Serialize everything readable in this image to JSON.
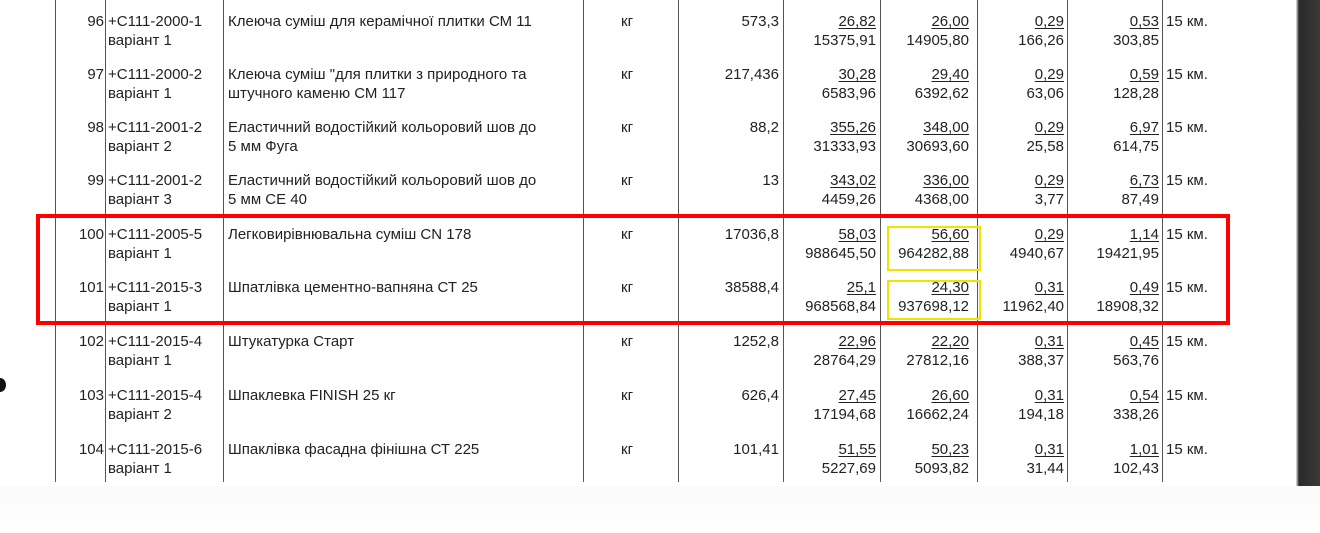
{
  "rows": [
    {
      "no": "96",
      "code": "+С111-2000-1",
      "variant": "варіант 1",
      "name1": "Клеюча суміш для керамічної плитки   СМ 11",
      "name2": "",
      "unit": "кг",
      "qty": "573,3",
      "c1": "26,82",
      "c1b": "15375,91",
      "c2": "26,00",
      "c2b": "14905,80",
      "c3": "0,29",
      "c3b": "166,26",
      "c4": "0,53",
      "c4b": "303,85",
      "dist": "15 км."
    },
    {
      "no": "97",
      "code": "+С111-2000-2",
      "variant": "варіант 1",
      "name1": "Клеюча суміш \"для плитки з природного та",
      "name2": "штучного каменю  СМ 117",
      "unit": "кг",
      "qty": "217,436",
      "c1": "30,28",
      "c1b": "6583,96",
      "c2": "29,40",
      "c2b": "6392,62",
      "c3": "0,29",
      "c3b": "63,06",
      "c4": "0,59",
      "c4b": "128,28",
      "dist": "15 км."
    },
    {
      "no": "98",
      "code": "+С111-2001-2",
      "variant": "варіант 2",
      "name1": "Еластичний водостійкий кольоровий шов до",
      "name2": "5 мм Фуга",
      "unit": "кг",
      "qty": "88,2",
      "c1": "355,26",
      "c1b": "31333,93",
      "c2": "348,00",
      "c2b": "30693,60",
      "c3": "0,29",
      "c3b": "25,58",
      "c4": "6,97",
      "c4b": "614,75",
      "dist": "15 км."
    },
    {
      "no": "99",
      "code": "+С111-2001-2",
      "variant": "варіант 3",
      "name1": "Еластичний водостійкий кольоровий шов до",
      "name2": "5 мм СЕ 40",
      "unit": "кг",
      "qty": "13",
      "c1": "343,02",
      "c1b": "4459,26",
      "c2": "336,00",
      "c2b": "4368,00",
      "c3": "0,29",
      "c3b": "3,77",
      "c4": "6,73",
      "c4b": "87,49",
      "dist": "15 км."
    },
    {
      "no": "100",
      "code": "+С111-2005-5",
      "variant": "варіант 1",
      "name1": "Легковирівнювальна суміш CN 178",
      "name2": "",
      "unit": "кг",
      "qty": "17036,8",
      "c1": "58,03",
      "c1b": "988645,50",
      "c2": "56,60",
      "c2b": "964282,88",
      "c3": "0,29",
      "c3b": "4940,67",
      "c4": "1,14",
      "c4b": "19421,95",
      "dist": "15 км."
    },
    {
      "no": "101",
      "code": "+С111-2015-3",
      "variant": "варіант 1",
      "name1": "Шпатлівка цементно-вапняна СТ 25",
      "name2": "",
      "unit": "кг",
      "qty": "38588,4",
      "c1": "25,1",
      "c1b": "968568,84",
      "c2": "24,30",
      "c2b": "937698,12",
      "c3": "0,31",
      "c3b": "11962,40",
      "c4": "0,49",
      "c4b": "18908,32",
      "dist": "15 км."
    },
    {
      "no": "102",
      "code": "+С111-2015-4",
      "variant": "варіант 1",
      "name1": "Штукатурка Старт",
      "name2": "",
      "unit": "кг",
      "qty": "1252,8",
      "c1": "22,96",
      "c1b": "28764,29",
      "c2": "22,20",
      "c2b": "27812,16",
      "c3": "0,31",
      "c3b": "388,37",
      "c4": "0,45",
      "c4b": "563,76",
      "dist": "15 км."
    },
    {
      "no": "103",
      "code": "+С111-2015-4",
      "variant": "варіант 2",
      "name1": "Шпаклевка  FINISH 25 кг",
      "name2": "",
      "unit": "кг",
      "qty": "626,4",
      "c1": "27,45",
      "c1b": "17194,68",
      "c2": "26,60",
      "c2b": "16662,24",
      "c3": "0,31",
      "c3b": "194,18",
      "c4": "0,54",
      "c4b": "338,26",
      "dist": "15 км."
    },
    {
      "no": "104",
      "code": "+С111-2015-6",
      "variant": "варіант 1",
      "name1": "Шпаклівка фасадна фінішна СТ 225",
      "name2": "",
      "unit": "кг",
      "qty": "101,41",
      "c1": "51,55",
      "c1b": "5227,69",
      "c2": "50,23",
      "c2b": "5093,82",
      "c3": "0,31",
      "c3b": "31,44",
      "c4": "1,01",
      "c4b": "102,43",
      "dist": "15 км."
    }
  ],
  "highlights": {
    "red_rows": [
      "100",
      "101"
    ],
    "yellow_cells": [
      "56,60 / 964282,88",
      "24,30 / 937698,12"
    ],
    "red_color": "#ff0000",
    "yellow_color": "#f2e200"
  }
}
